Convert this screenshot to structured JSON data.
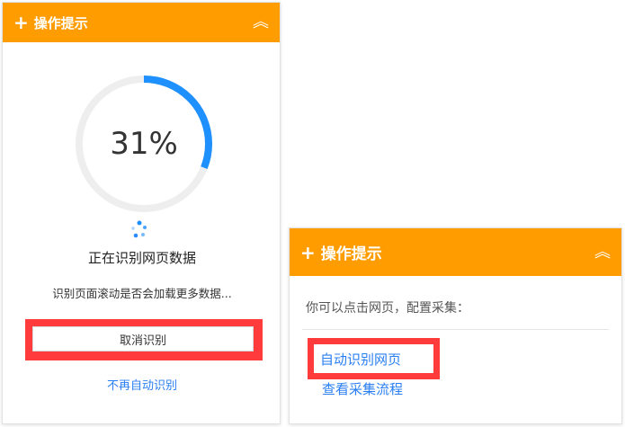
{
  "left_panel": {
    "header": {
      "title": "操作提示",
      "plus_icon": "plus-icon",
      "collapse_icon": "chevron-double-up-icon"
    },
    "progress": {
      "value": 0.31,
      "label": "31%",
      "track_color": "#eeeeee",
      "fill_color": "#1e90ff"
    },
    "status_title": "正在识别网页数据",
    "status_sub": "识别页面滚动是否会加载更多数据...",
    "cancel_label": "取消识别",
    "no_auto_label": "不再自动识别"
  },
  "right_panel": {
    "header": {
      "title": "操作提示",
      "plus_icon": "plus-icon",
      "collapse_icon": "chevron-double-up-icon"
    },
    "hint": "你可以点击网页，配置采集：",
    "links": {
      "auto": "自动识别网页",
      "flow": "查看采集流程"
    }
  },
  "colors": {
    "header_bg": "#ff9c00",
    "highlight": "#ff3b3b",
    "link": "#2a7ff3"
  }
}
